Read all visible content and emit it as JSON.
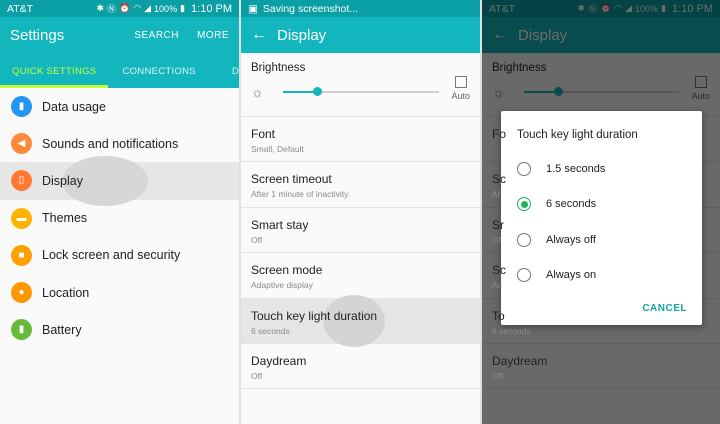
{
  "colors": {
    "accent": "#14b6bd",
    "status_bar": "#0a9fa5",
    "tab_active": "#c6ff3b",
    "radio_on": "#1cb35e"
  },
  "status_bar": {
    "carrier": "AT&T",
    "saving_text": "Saving screenshot...",
    "battery_level": "100%",
    "time": "1:10 PM"
  },
  "settings": {
    "title": "Settings",
    "actions": {
      "search": "SEARCH",
      "more": "MORE"
    },
    "tabs": [
      {
        "label": "QUICK SETTINGS",
        "active": true
      },
      {
        "label": "CONNECTIONS",
        "active": false
      },
      {
        "label": "DEVI",
        "active": false
      }
    ],
    "items": [
      {
        "label": "Data usage",
        "icon": "data-usage-icon",
        "color": "#2196f3"
      },
      {
        "label": "Sounds and notifications",
        "icon": "volume-icon",
        "color": "#ff8a3d"
      },
      {
        "label": "Display",
        "icon": "display-icon",
        "color": "#ff7a30"
      },
      {
        "label": "Themes",
        "icon": "brush-icon",
        "color": "#ffb300"
      },
      {
        "label": "Lock screen and security",
        "icon": "lock-icon",
        "color": "#ffa000"
      },
      {
        "label": "Location",
        "icon": "location-icon",
        "color": "#ff9800"
      },
      {
        "label": "Battery",
        "icon": "battery-icon",
        "color": "#66bb3a"
      }
    ]
  },
  "display": {
    "title": "Display",
    "brightness": {
      "label": "Brightness",
      "level": 0.22,
      "auto_label": "Auto"
    },
    "items": [
      {
        "title": "Font",
        "subtitle": "Small, Default"
      },
      {
        "title": "Screen timeout",
        "subtitle": "After 1 minute of inactivity."
      },
      {
        "title": "Smart stay",
        "subtitle": "Off"
      },
      {
        "title": "Screen mode",
        "subtitle": "Adaptive display"
      },
      {
        "title": "Touch key light duration",
        "subtitle": "6 seconds"
      },
      {
        "title": "Daydream",
        "subtitle": "Off"
      }
    ],
    "dimmed_partial": {
      "t0": "Fo",
      "t1": "Sc",
      "t2": "Sr",
      "t3": "Sc",
      "t4": "To",
      "s1": "Af",
      "s2": "Of",
      "s3": "Ac",
      "s4": "6 seconds"
    }
  },
  "dialog": {
    "title": "Touch key light duration",
    "options": [
      {
        "label": "1.5 seconds",
        "selected": false
      },
      {
        "label": "6 seconds",
        "selected": true
      },
      {
        "label": "Always off",
        "selected": false
      },
      {
        "label": "Always on",
        "selected": false
      }
    ],
    "cancel_label": "CANCEL"
  }
}
